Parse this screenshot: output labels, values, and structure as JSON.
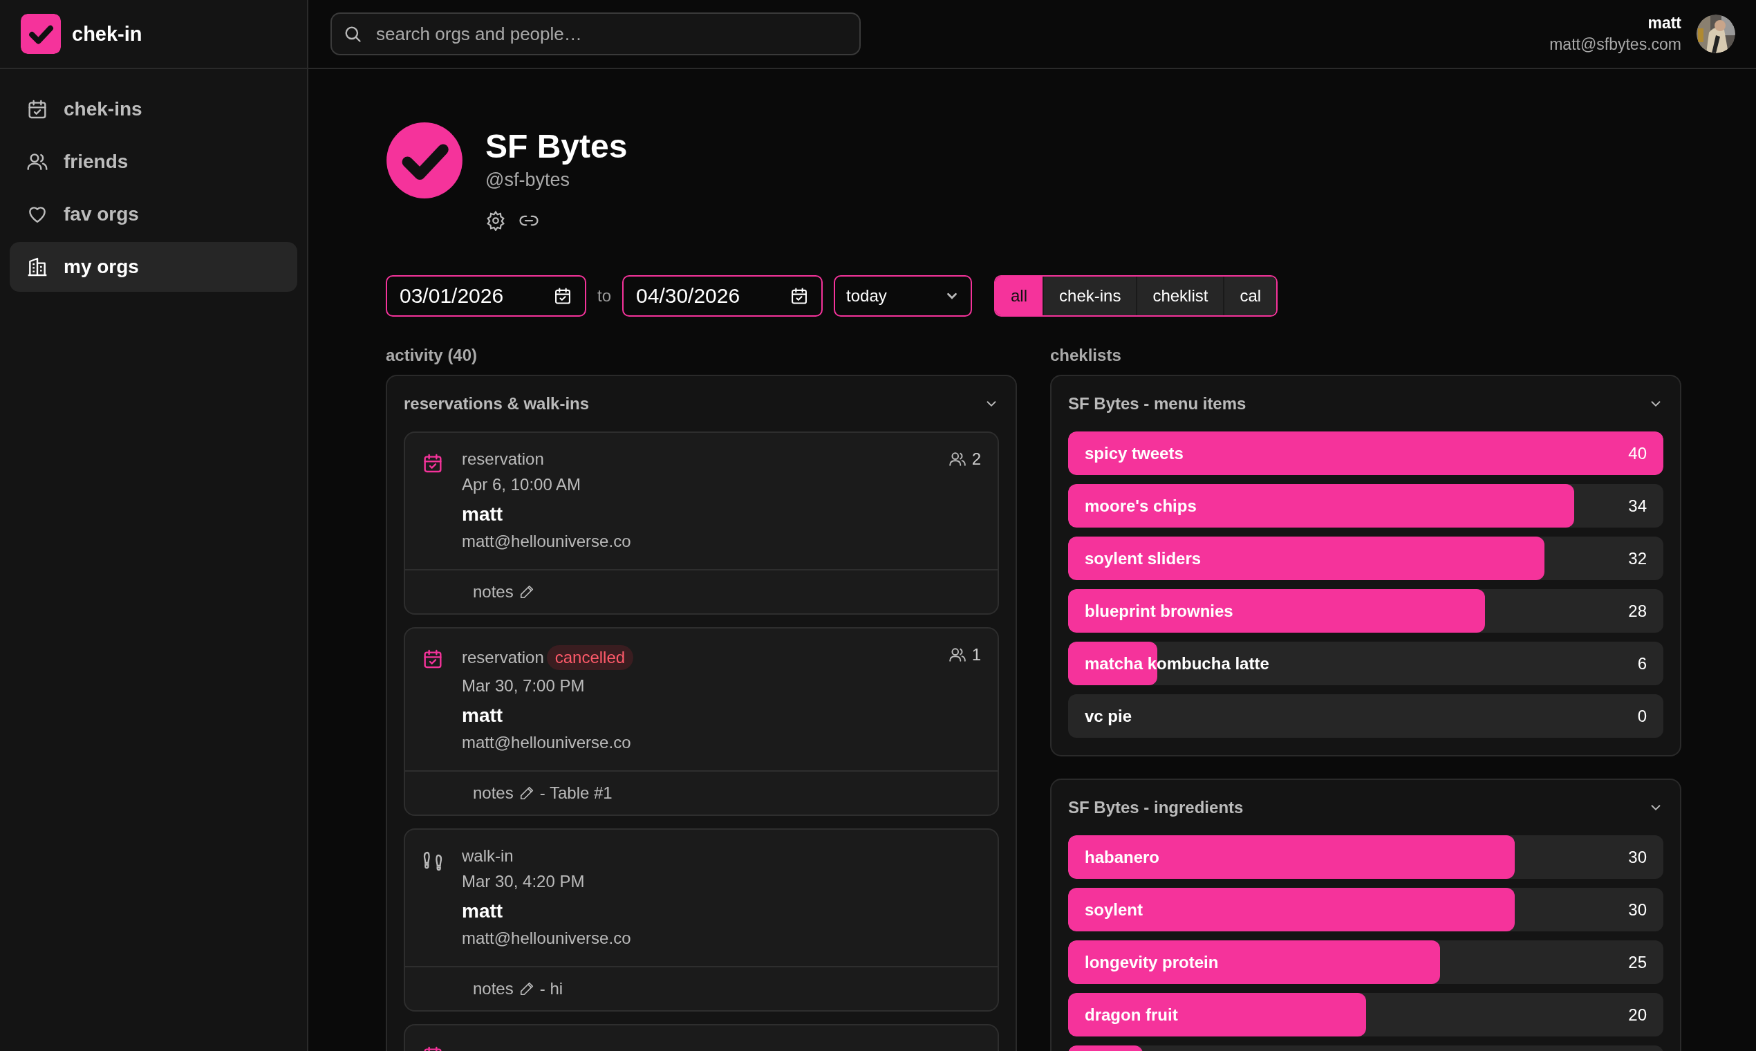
{
  "app": {
    "name": "chek-in"
  },
  "search": {
    "placeholder": "search orgs and people…"
  },
  "user": {
    "name": "matt",
    "email": "matt@sfbytes.com"
  },
  "sidebar": {
    "items": [
      {
        "label": "chek-ins",
        "selected": false
      },
      {
        "label": "friends",
        "selected": false
      },
      {
        "label": "fav orgs",
        "selected": false
      },
      {
        "label": "my orgs",
        "selected": true
      }
    ]
  },
  "org": {
    "name": "SF Bytes",
    "handle": "@sf-bytes"
  },
  "filters": {
    "start_date": "03/01/2026",
    "to": "to",
    "end_date": "04/30/2026",
    "preset": "today",
    "tabs": [
      {
        "label": "all",
        "selected": true
      },
      {
        "label": "chek-ins",
        "selected": false
      },
      {
        "label": "cheklist",
        "selected": false
      },
      {
        "label": "cal",
        "selected": false
      }
    ]
  },
  "activity": {
    "title": "activity (40)",
    "section": "reservations & walk-ins",
    "items": [
      {
        "kind": "reservation",
        "type": "reservation",
        "date": "Apr 6, 10:00 AM",
        "name": "matt",
        "email": "matt@hellouniverse.co",
        "party": "2",
        "notes": "notes"
      },
      {
        "kind": "reservation",
        "type": "reservation",
        "status": "cancelled",
        "date": "Mar 30, 7:00 PM",
        "name": "matt",
        "email": "matt@hellouniverse.co",
        "party": "1",
        "notes": "notes",
        "note_text": "- Table #1"
      },
      {
        "kind": "walk-in",
        "type": "walk-in",
        "date": "Mar 30, 4:20 PM",
        "name": "matt",
        "email": "matt@hellouniverse.co",
        "notes": "notes",
        "note_text": "- hi"
      },
      {
        "kind": "reservation"
      }
    ]
  },
  "cheklists": {
    "title": "cheklists",
    "lists": [
      {
        "title": "SF Bytes - menu items",
        "items": [
          {
            "label": "spicy tweets",
            "count": "40",
            "level": 1.0
          },
          {
            "label": "moore's chips",
            "count": "34",
            "level": 0.85
          },
          {
            "label": "soylent sliders",
            "count": "32",
            "level": 0.8
          },
          {
            "label": "blueprint brownies",
            "count": "28",
            "level": 0.7
          },
          {
            "label": "matcha kombucha latte",
            "count": "6",
            "level": 0.15
          },
          {
            "label": "vc pie",
            "count": "0",
            "level": 0
          }
        ]
      },
      {
        "title": "SF Bytes - ingredients",
        "items": [
          {
            "label": "habanero",
            "count": "30",
            "level": 0.75
          },
          {
            "label": "soylent",
            "count": "30",
            "level": 0.75
          },
          {
            "label": "longevity protein",
            "count": "25",
            "level": 0.625
          },
          {
            "label": "dragon fruit",
            "count": "20",
            "level": 0.5
          },
          {
            "level": 0.125
          }
        ]
      }
    ]
  }
}
